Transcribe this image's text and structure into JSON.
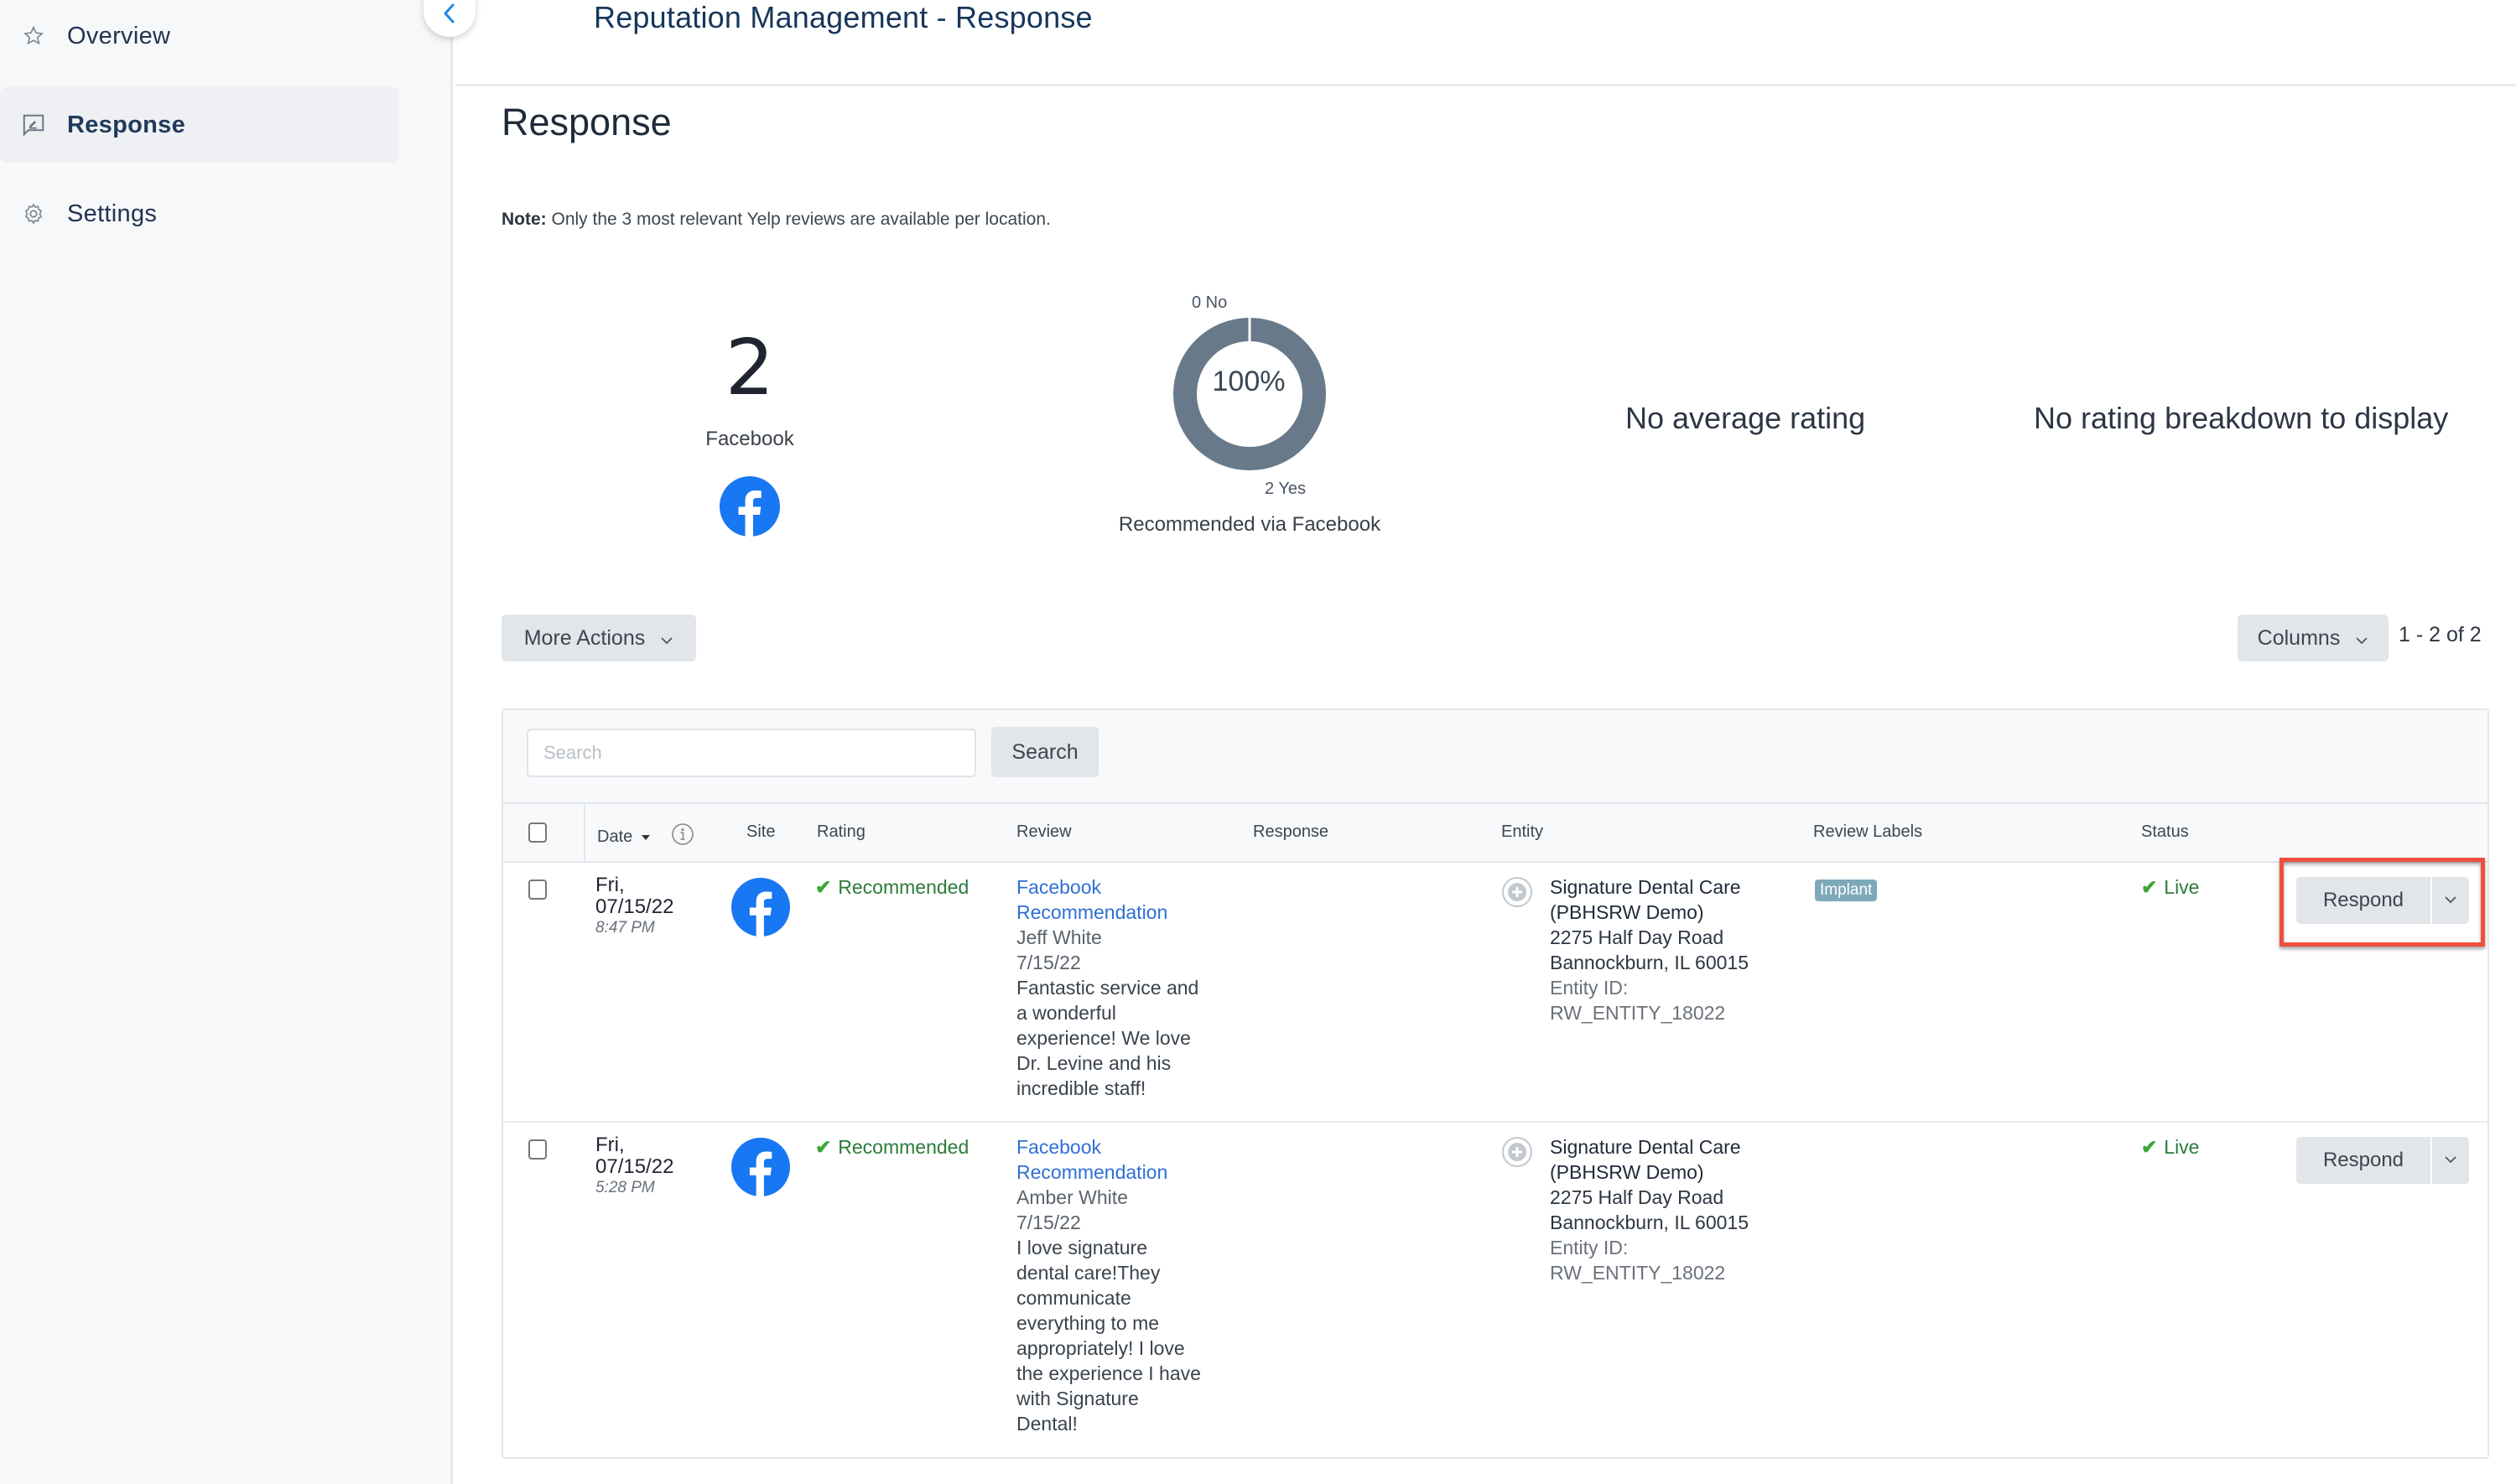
{
  "sidebar": {
    "items": [
      {
        "label": "Overview",
        "icon": "star-icon",
        "active": false
      },
      {
        "label": "Response",
        "icon": "response-icon",
        "active": true
      },
      {
        "label": "Settings",
        "icon": "gear-icon",
        "active": false
      }
    ],
    "collapse_icon": "chevron-left-icon"
  },
  "header": {
    "title": "Reputation Management - Response"
  },
  "page": {
    "title": "Response",
    "note_label": "Note:",
    "note_text": " Only the 3 most relevant Yelp reviews are available per location."
  },
  "stats": {
    "count": "2",
    "count_label": "Facebook",
    "site_icon": "facebook-icon",
    "no_average": "No average rating",
    "no_breakdown": "No rating breakdown to display"
  },
  "chart_data": {
    "type": "pie",
    "title": "Recommended via Facebook",
    "center_label": "100%",
    "slices": [
      {
        "name": "No",
        "value": 0,
        "label": "0 No",
        "color": "#ffffff"
      },
      {
        "name": "Yes",
        "value": 2,
        "label": "2 Yes",
        "color": "#687a89"
      }
    ],
    "donut": true
  },
  "toolbar": {
    "more_actions": "More Actions",
    "columns": "Columns",
    "pager": "1 - 2 of 2"
  },
  "search": {
    "placeholder": "Search",
    "value": "",
    "button": "Search"
  },
  "table": {
    "columns": [
      "Date",
      "Site",
      "Rating",
      "Review",
      "Response",
      "Entity",
      "Review Labels",
      "Status"
    ],
    "sort_column": "Date",
    "sort_direction": "descending",
    "rows": [
      {
        "date_day": "Fri,",
        "date": "07/15/22",
        "time": "8:47 PM",
        "site": "facebook",
        "rating": "Recommended",
        "review_title_1": "Facebook",
        "review_title_2": "Recommendation",
        "reviewer": "Jeff White",
        "review_date": "7/15/22",
        "review_lines": [
          "Fantastic service and",
          "a wonderful",
          "experience! We love",
          "Dr. Levine and his",
          "incredible staff!"
        ],
        "response": "",
        "entity_name_1": "Signature Dental Care",
        "entity_name_2": "(PBHSRW Demo)",
        "entity_addr_1": "2275 Half Day Road",
        "entity_addr_2": "Bannockburn, IL 60015",
        "entity_id_label": "Entity ID:",
        "entity_id": "RW_ENTITY_18022",
        "labels": [
          "Implant"
        ],
        "status": "Live",
        "action": "Respond",
        "highlighted": true
      },
      {
        "date_day": "Fri,",
        "date": "07/15/22",
        "time": "5:28 PM",
        "site": "facebook",
        "rating": "Recommended",
        "review_title_1": "Facebook",
        "review_title_2": "Recommendation",
        "reviewer": "Amber White",
        "review_date": "7/15/22",
        "review_lines": [
          "I love signature",
          "dental care!They",
          "communicate",
          "everything to me",
          "appropriately! I love",
          "the experience I have",
          "with Signature",
          "Dental!"
        ],
        "response": "",
        "entity_name_1": "Signature Dental Care",
        "entity_name_2": "(PBHSRW Demo)",
        "entity_addr_1": "2275 Half Day Road",
        "entity_addr_2": "Bannockburn, IL 60015",
        "entity_id_label": "Entity ID:",
        "entity_id": "RW_ENTITY_18022",
        "labels": [],
        "status": "Live",
        "action": "Respond",
        "highlighted": false
      }
    ]
  },
  "colors": {
    "accent_blue": "#2f6fd6",
    "facebook_blue": "#1877f2",
    "success_green": "#3aa635",
    "highlight_red": "#f04e3e",
    "donut_fill": "#687a89",
    "label_badge": "#7ea9bb"
  }
}
